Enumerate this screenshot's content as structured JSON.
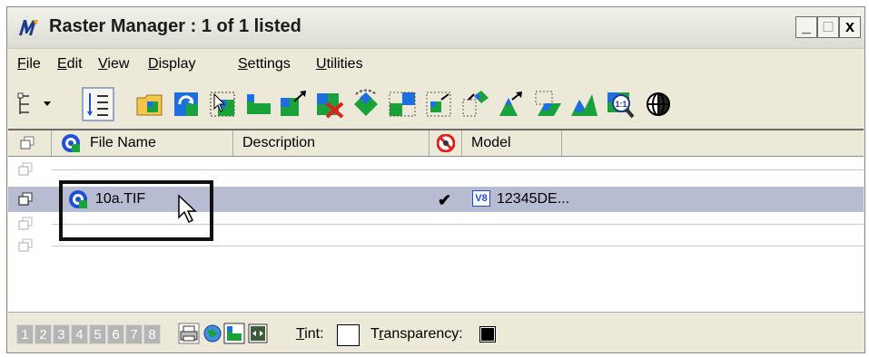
{
  "window": {
    "title": "Raster Manager : 1 of 1 listed",
    "minimize_label": "_",
    "maximize_label": "□",
    "close_label": "x"
  },
  "menu": [
    {
      "label": "File",
      "accel": "F",
      "rest": "ile"
    },
    {
      "label": "Edit",
      "accel": "E",
      "rest": "dit"
    },
    {
      "label": "View",
      "accel": "V",
      "rest": "iew"
    },
    {
      "label": "Display",
      "accel": "D",
      "rest": "isplay"
    },
    {
      "label": "Settings",
      "accel": "S",
      "rest": "ettings"
    },
    {
      "label": "Utilities",
      "accel": "U",
      "rest": "tilities"
    }
  ],
  "table": {
    "columns": [
      "File Name",
      "Description",
      "Model"
    ],
    "rows": [
      {
        "file": "",
        "description": "",
        "display": "",
        "model": ""
      },
      {
        "file": "10a.TIF",
        "description": "",
        "display": "✔",
        "model": "12345DE..."
      },
      {
        "file": "",
        "description": "",
        "display": "",
        "model": ""
      },
      {
        "file": "",
        "description": "",
        "display": "",
        "model": ""
      }
    ],
    "model_badge": "V8"
  },
  "statusbar": {
    "views": [
      "1",
      "2",
      "3",
      "4",
      "5",
      "6",
      "7",
      "8"
    ],
    "tint_label": "Tint:",
    "tint_accel": "T",
    "tint_rest": "int:",
    "transparency_label": "Transparency:",
    "transparency_accel": "r",
    "transparency_pre": "T",
    "transparency_rest": "ansparency:"
  },
  "colors": {
    "selected_row": "#b8bcd3",
    "window_bg": "#ece9d8",
    "view_button": "#b5b5b5"
  }
}
